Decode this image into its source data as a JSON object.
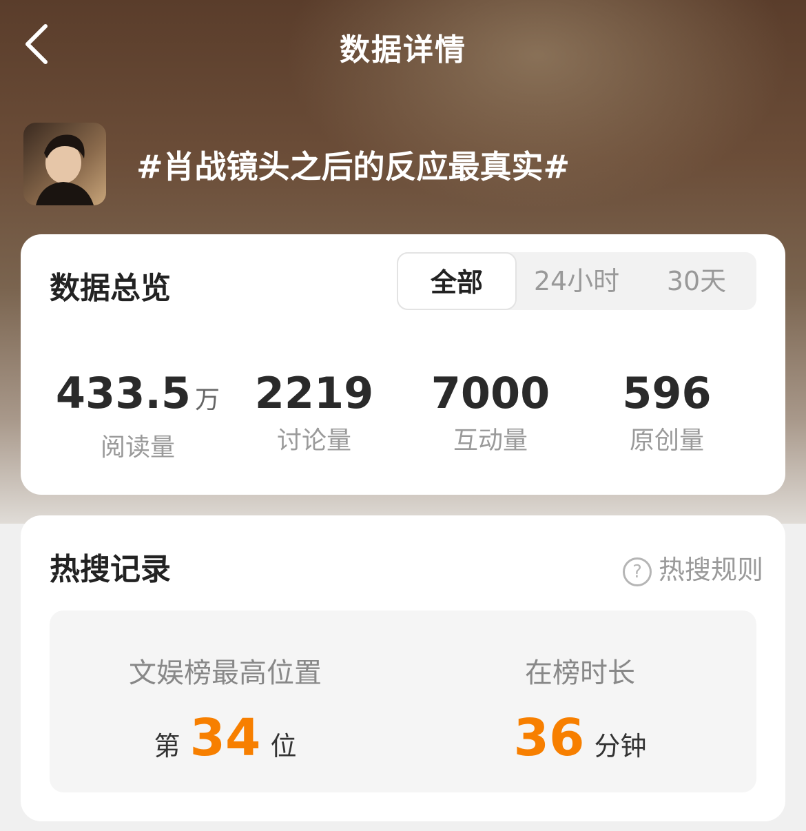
{
  "header": {
    "title": "数据详情",
    "topic": "#肖战镜头之后的反应最真实#"
  },
  "overview": {
    "title": "数据总览",
    "tabs": [
      {
        "label": "全部",
        "active": true
      },
      {
        "label": "24小时",
        "active": false
      },
      {
        "label": "30天",
        "active": false
      }
    ],
    "stats": [
      {
        "value": "433.5",
        "unit": "万",
        "label": "阅读量"
      },
      {
        "value": "2219",
        "label": "讨论量"
      },
      {
        "value": "7000",
        "label": "互动量"
      },
      {
        "value": "596",
        "label": "原创量"
      }
    ]
  },
  "hot_search": {
    "title": "热搜记录",
    "rules_label": "热搜规则",
    "best_position": {
      "label": "文娱榜最高位置",
      "prefix": "第",
      "value": "34",
      "suffix": "位"
    },
    "duration": {
      "label": "在榜时长",
      "value": "36",
      "unit": "分钟"
    }
  },
  "colors": {
    "accent_orange": "#f77f00",
    "text_dark": "#222222",
    "text_muted": "#9a9a9a"
  },
  "icons": [
    "back-arrow-icon",
    "question-circle-icon"
  ]
}
